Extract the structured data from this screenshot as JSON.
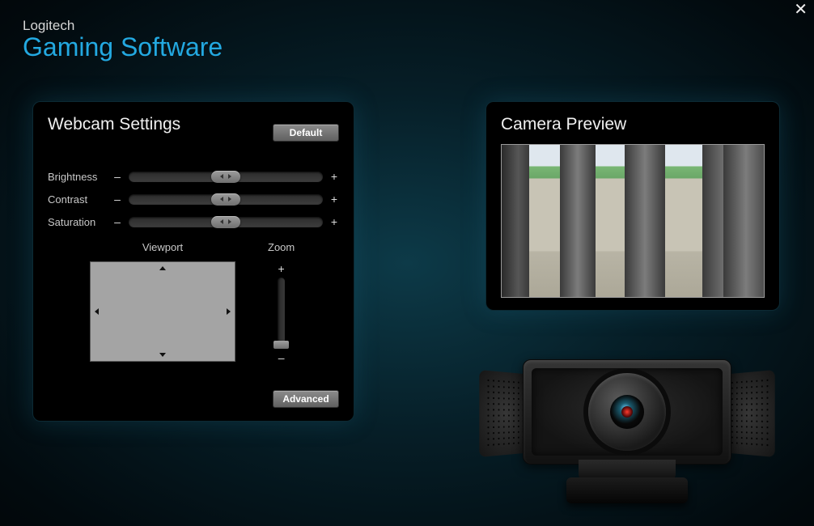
{
  "window": {
    "close_glyph": "✕"
  },
  "header": {
    "brand": "Logitech",
    "title": "Gaming Software"
  },
  "settings": {
    "title": "Webcam Settings",
    "default_label": "Default",
    "advanced_label": "Advanced",
    "minus": "–",
    "plus": "+",
    "sliders": {
      "brightness": {
        "label": "Brightness",
        "value": 50
      },
      "contrast": {
        "label": "Contrast",
        "value": 50
      },
      "saturation": {
        "label": "Saturation",
        "value": 50
      }
    },
    "viewport_label": "Viewport",
    "zoom": {
      "label": "Zoom",
      "plus": "+",
      "minus": "–",
      "value": 0
    }
  },
  "preview": {
    "title": "Camera Preview"
  }
}
